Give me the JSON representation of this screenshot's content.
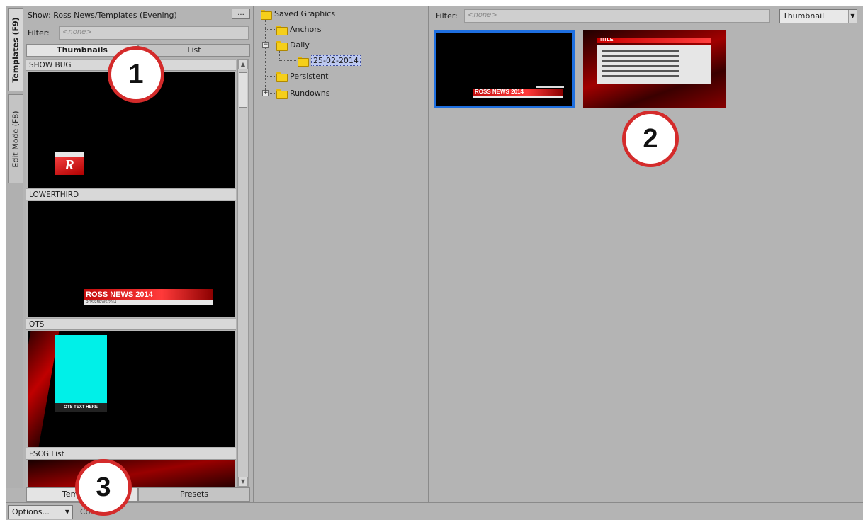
{
  "side_tabs": {
    "templates": "Templates (F9)",
    "edit_mode": "Edit Mode (F8)"
  },
  "templates_panel": {
    "show": "Show: Ross News/Templates (Evening)",
    "browse_label": "...",
    "filter_label": "Filter:",
    "filter_placeholder": "<none>",
    "view_tabs": [
      "Thumbnails",
      "List"
    ],
    "items": [
      {
        "label": "SHOW BUG",
        "graphic_text": "R"
      },
      {
        "label": "LOWERTHIRD",
        "graphic_title": "ROSS NEWS 2014",
        "graphic_subtitle": "ROSS NEWS 2014"
      },
      {
        "label": "OTS",
        "graphic_text": "OTS TEXT HERE"
      },
      {
        "label": "FSCG List"
      }
    ],
    "bottom_tabs": [
      "Templates",
      "Presets"
    ]
  },
  "tree": {
    "root": "Saved Graphics",
    "anchors": "Anchors",
    "daily": "Daily",
    "daily_child": "25-02-2014",
    "persistent": "Persistent",
    "rundowns": "Rundowns"
  },
  "preview": {
    "filter_label": "Filter:",
    "filter_placeholder": "<none>",
    "view_mode": "Thumbnail",
    "thumb1_title": "ROSS NEWS 2014",
    "thumb2_title": "TITLE"
  },
  "bottom_bar": {
    "options_label": "Options...",
    "status_text": "Conne..."
  },
  "callouts": [
    "1",
    "2",
    "3"
  ],
  "colors": {
    "selection_border": "#1e6fe0",
    "callout_ring": "#d42b2b",
    "ots_box": "#00f0e8",
    "graphic_red": "#e02020"
  }
}
